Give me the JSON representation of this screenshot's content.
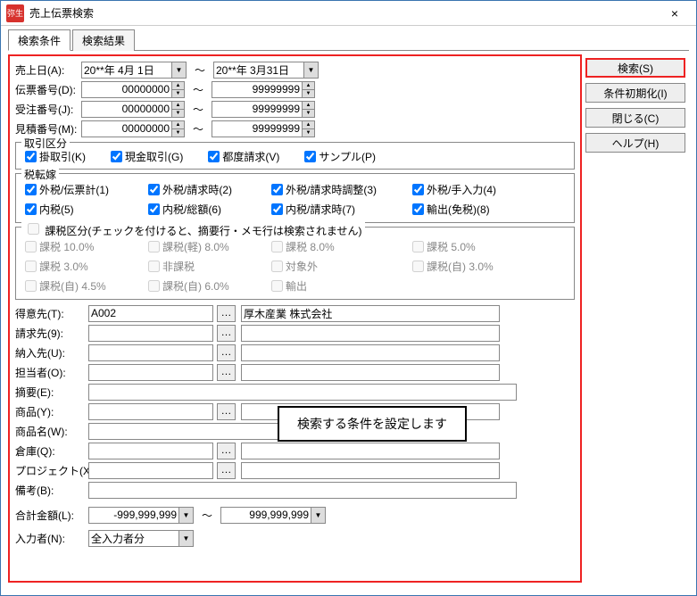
{
  "window": {
    "title": "売上伝票検索",
    "close": "×",
    "logo": "弥生"
  },
  "tabs": [
    {
      "label": "検索条件",
      "active": true
    },
    {
      "label": "検索結果",
      "active": false
    }
  ],
  "buttons": {
    "search": "検索(S)",
    "reset": "条件初期化(I)",
    "close": "閉じる(C)",
    "help": "ヘルプ(H)"
  },
  "rows": {
    "date": {
      "label": "売上日(A):",
      "from": "20**年 4月 1日",
      "to": "20**年 3月31日"
    },
    "slipno": {
      "label": "伝票番号(D):",
      "from": "00000000",
      "to": "99999999"
    },
    "orderno": {
      "label": "受注番号(J):",
      "from": "00000000",
      "to": "99999999"
    },
    "estno": {
      "label": "見積番号(M):",
      "from": "00000000",
      "to": "99999999"
    }
  },
  "group1": {
    "legend": "取引区分",
    "items": [
      {
        "label": "掛取引(K)",
        "checked": true
      },
      {
        "label": "現金取引(G)",
        "checked": true
      },
      {
        "label": "都度請求(V)",
        "checked": true
      },
      {
        "label": "サンプル(P)",
        "checked": true
      }
    ]
  },
  "group2": {
    "legend": "税転嫁",
    "items": [
      {
        "label": "外税/伝票計(1)",
        "checked": true
      },
      {
        "label": "外税/請求時(2)",
        "checked": true
      },
      {
        "label": "外税/請求時調整(3)",
        "checked": true
      },
      {
        "label": "外税/手入力(4)",
        "checked": true
      },
      {
        "label": "内税(5)",
        "checked": true
      },
      {
        "label": "内税/総額(6)",
        "checked": true
      },
      {
        "label": "内税/請求時(7)",
        "checked": true
      },
      {
        "label": "輸出(免税)(8)",
        "checked": true
      }
    ]
  },
  "group3": {
    "legend": "課税区分(チェックを付けると、摘要行・メモ行は検索されません)",
    "items": [
      {
        "label": "課税 10.0%"
      },
      {
        "label": "課税(軽) 8.0%"
      },
      {
        "label": "課税 8.0%"
      },
      {
        "label": "課税 5.0%"
      },
      {
        "label": "課税 3.0%"
      },
      {
        "label": "非課税"
      },
      {
        "label": "対象外"
      },
      {
        "label": "課税(自) 3.0%"
      },
      {
        "label": "課税(自) 4.5%"
      },
      {
        "label": "課税(自) 6.0%"
      },
      {
        "label": "輸出"
      }
    ]
  },
  "lower": {
    "customer": {
      "label": "得意先(T):",
      "code": "A002",
      "name": "厚木産業  株式会社"
    },
    "billto": {
      "label": "請求先(9):",
      "code": "",
      "name": ""
    },
    "shipto": {
      "label": "納入先(U):",
      "code": "",
      "name": ""
    },
    "assignee": {
      "label": "担当者(O):",
      "code": "",
      "name": ""
    },
    "summary": {
      "label": "摘要(E):",
      "val": ""
    },
    "product": {
      "label": "商品(Y):",
      "code": "",
      "name": ""
    },
    "productName": {
      "label": "商品名(W):",
      "val": ""
    },
    "warehouse": {
      "label": "倉庫(Q):",
      "code": "",
      "name": ""
    },
    "project": {
      "label": "プロジェクト(X):",
      "code": "",
      "name": ""
    },
    "remark": {
      "label": "備考(B):",
      "val": ""
    },
    "amount": {
      "label": "合計金額(L):",
      "from": "-999,999,999",
      "to": "999,999,999"
    },
    "inputuser": {
      "label": "入力者(N):",
      "val": "全入力者分"
    }
  },
  "callout": "検索する条件を設定します"
}
